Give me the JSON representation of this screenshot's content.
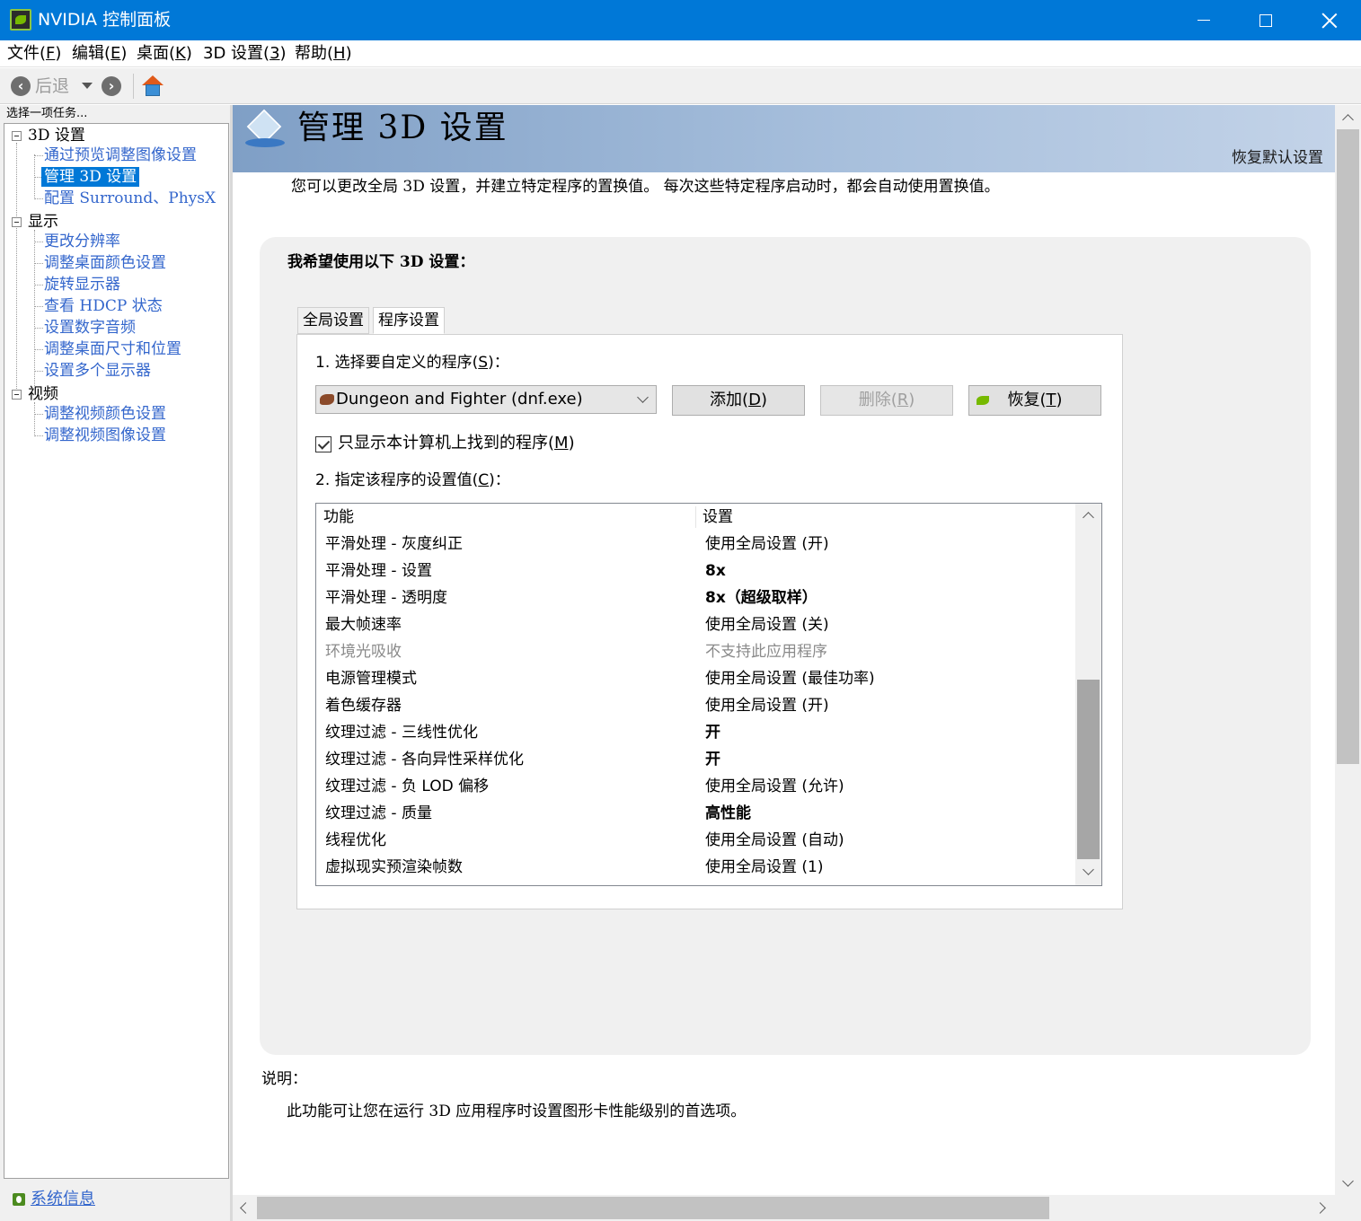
{
  "window": {
    "title": "NVIDIA 控制面板"
  },
  "menu": {
    "items": [
      {
        "label": "文件(",
        "key": "F",
        "suffix": ")"
      },
      {
        "label": "编辑(",
        "key": "E",
        "suffix": ")"
      },
      {
        "label": "桌面(",
        "key": "K",
        "suffix": ")"
      },
      {
        "label": "3D 设置(",
        "key": "3",
        "suffix": ")"
      },
      {
        "label": "帮助(",
        "key": "H",
        "suffix": ")"
      }
    ]
  },
  "toolbar": {
    "back_label": "后退"
  },
  "left_panel": {
    "caption": "选择一项任务...",
    "groups": [
      {
        "label": "3D 设置",
        "items": [
          "通过预览调整图像设置",
          "管理 3D 设置",
          "配置 Surround、PhysX"
        ]
      },
      {
        "label": "显示",
        "items": [
          "更改分辨率",
          "调整桌面颜色设置",
          "旋转显示器",
          "查看 HDCP 状态",
          "设置数字音频",
          "调整桌面尺寸和位置",
          "设置多个显示器"
        ]
      },
      {
        "label": "视频",
        "items": [
          "调整视频颜色设置",
          "调整视频图像设置"
        ]
      }
    ],
    "selected_item": "管理 3D 设置",
    "system_info": "系统信息"
  },
  "content": {
    "title": "管理 3D 设置",
    "restore_defaults": "恢复默认设置",
    "intro": "您可以更改全局 3D 设置，并建立特定程序的置换值。 每次这些特定程序启动时，都会自动使用置换值。",
    "panel_heading": "我希望使用以下 3D 设置：",
    "tabs": [
      "全局设置",
      "程序设置"
    ],
    "active_tab": "程序设置",
    "step1": {
      "prefix": "1. 选择要自定义的程序(",
      "key": "S",
      "suffix": ")："
    },
    "program_select": "Dungeon and Fighter (dnf.exe)",
    "buttons": {
      "add": {
        "prefix": "添加(",
        "key": "D",
        "suffix": ")"
      },
      "remove": {
        "prefix": "删除(",
        "key": "R",
        "suffix": ")"
      },
      "restore": {
        "prefix": "恢复(",
        "key": "T",
        "suffix": ")"
      }
    },
    "checkbox": {
      "prefix": "只显示本计算机上找到的程序(",
      "key": "M",
      "suffix": ")",
      "checked": true
    },
    "step2": {
      "prefix": "2. 指定该程序的设置值(",
      "key": "C",
      "suffix": ")："
    },
    "table": {
      "headers": [
        "功能",
        "设置"
      ],
      "rows": [
        {
          "feature": "平滑处理 - 灰度纠正",
          "setting": "使用全局设置 (开)",
          "bold": false,
          "disabled": false
        },
        {
          "feature": "平滑处理 - 设置",
          "setting": "8x",
          "bold": true,
          "disabled": false
        },
        {
          "feature": "平滑处理 - 透明度",
          "setting": "8x（超级取样）",
          "bold": true,
          "disabled": false
        },
        {
          "feature": "最大帧速率",
          "setting": "使用全局设置 (关)",
          "bold": false,
          "disabled": false
        },
        {
          "feature": "环境光吸收",
          "setting": "不支持此应用程序",
          "bold": false,
          "disabled": true
        },
        {
          "feature": "电源管理模式",
          "setting": "使用全局设置 (最佳功率)",
          "bold": false,
          "disabled": false
        },
        {
          "feature": "着色缓存器",
          "setting": "使用全局设置 (开)",
          "bold": false,
          "disabled": false
        },
        {
          "feature": "纹理过滤 - 三线性优化",
          "setting": "开",
          "bold": true,
          "disabled": false
        },
        {
          "feature": "纹理过滤 - 各向异性采样优化",
          "setting": "开",
          "bold": true,
          "disabled": false
        },
        {
          "feature": "纹理过滤 - 负 LOD 偏移",
          "setting": "使用全局设置 (允许)",
          "bold": false,
          "disabled": false
        },
        {
          "feature": "纹理过滤 - 质量",
          "setting": "高性能",
          "bold": true,
          "disabled": false
        },
        {
          "feature": "线程优化",
          "setting": "使用全局设置 (自动)",
          "bold": false,
          "disabled": false
        },
        {
          "feature": "虚拟现实预渲染帧数",
          "setting": "使用全局设置 (1)",
          "bold": false,
          "disabled": false
        }
      ]
    },
    "description_label": "说明：",
    "description_text": "此功能可让您在运行 3D 应用程序时设置图形卡性能级别的首选项。"
  },
  "colors": {
    "titlebar": "#0078d7",
    "link": "#3366cc",
    "selection": "#0078d7",
    "nvidia_green": "#76b900"
  }
}
